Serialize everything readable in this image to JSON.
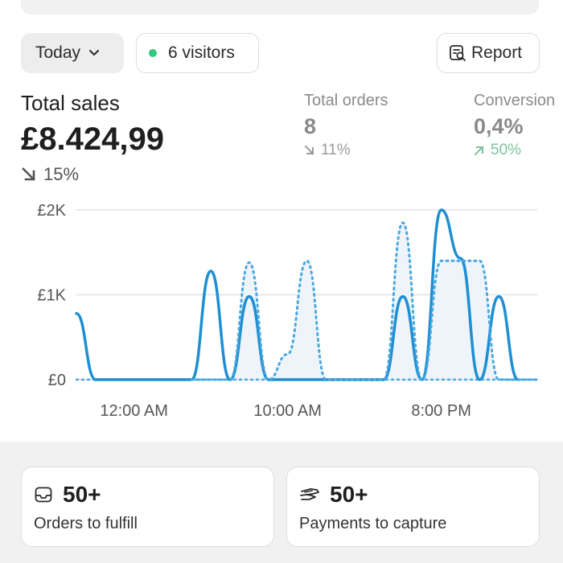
{
  "filters": {
    "period_label": "Today",
    "visitors_label": "6 visitors",
    "report_label": "Report"
  },
  "metrics": {
    "total_sales": {
      "label": "Total sales",
      "value": "£8.424,99",
      "change": "15%",
      "direction": "down"
    },
    "total_orders": {
      "label": "Total orders",
      "value": "8",
      "change": "11%",
      "direction": "down"
    },
    "conversion": {
      "label": "Conversion",
      "value": "0,4%",
      "change": "50%",
      "direction": "up"
    }
  },
  "colors": {
    "accent_line": "#1e8fd2",
    "accent_light": "#4aa8e0",
    "positive": "#7fc29c",
    "online_dot": "#2ec97a"
  },
  "chart_data": {
    "type": "line",
    "y_tick_labels": [
      "£2K",
      "£1K",
      "£0"
    ],
    "x_tick_labels": [
      "12:00 AM",
      "10:00 AM",
      "8:00 PM"
    ],
    "ylim": [
      0,
      2000
    ],
    "x_unit": "hour of day",
    "grid": true,
    "series": [
      {
        "style": "solid",
        "points": [
          [
            0,
            780
          ],
          [
            1,
            0
          ],
          [
            6,
            0
          ],
          [
            7,
            1280
          ],
          [
            8,
            0
          ],
          [
            9,
            980
          ],
          [
            10,
            0
          ],
          [
            16,
            0
          ],
          [
            17,
            980
          ],
          [
            18,
            0
          ],
          [
            19,
            2000
          ],
          [
            20,
            1430
          ],
          [
            21,
            0
          ],
          [
            22,
            980
          ],
          [
            23,
            0
          ]
        ]
      },
      {
        "style": "dotted",
        "points": [
          [
            6,
            0
          ],
          [
            8,
            0
          ],
          [
            9,
            1380
          ],
          [
            10,
            0
          ],
          [
            11,
            300
          ],
          [
            12,
            1400
          ],
          [
            13,
            0
          ],
          [
            16,
            0
          ],
          [
            17,
            1850
          ],
          [
            18,
            0
          ],
          [
            19,
            1400
          ],
          [
            21,
            1400
          ],
          [
            22,
            0
          ],
          [
            24,
            0
          ]
        ]
      }
    ]
  },
  "cards": [
    {
      "value": "50+",
      "label": "Orders to fulfill",
      "icon": "inbox-icon"
    },
    {
      "value": "50+",
      "label": "Payments to capture",
      "icon": "hand-payment-icon"
    }
  ]
}
